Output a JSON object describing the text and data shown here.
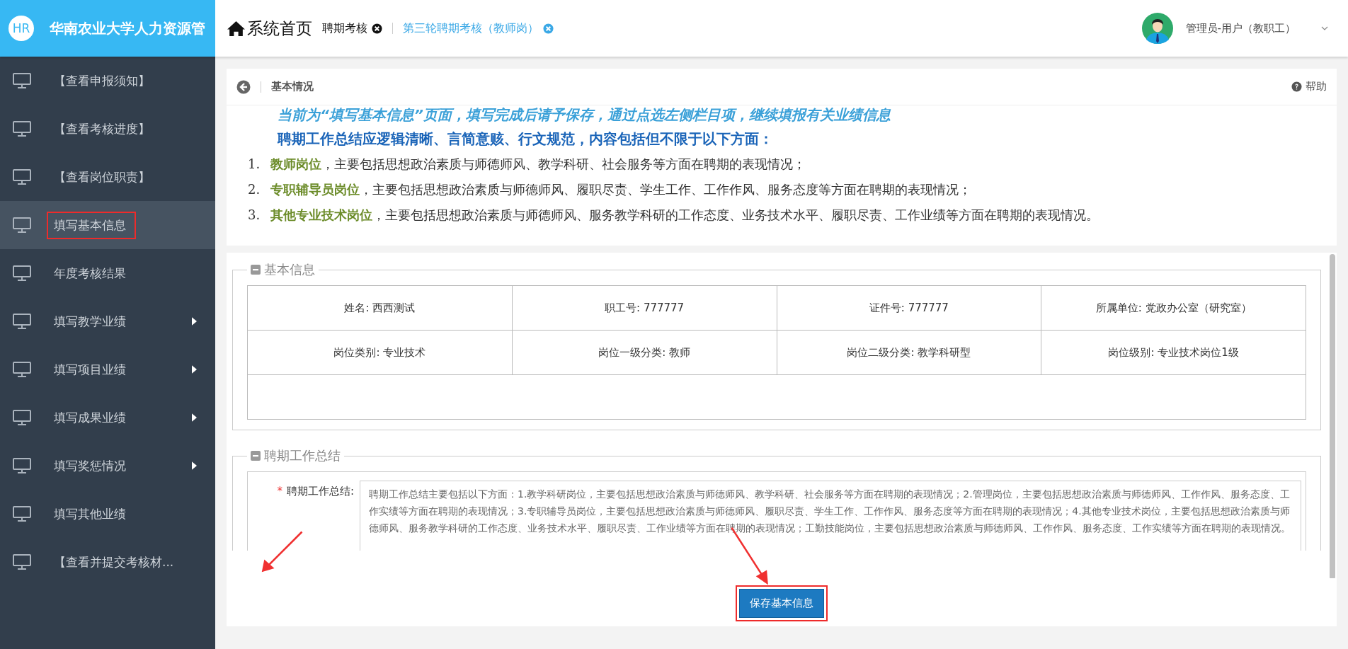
{
  "brand": {
    "logo": "HR",
    "title": "华南农业大学人力资源管"
  },
  "tabs": [
    {
      "label": "系统首页",
      "kind": "home",
      "selected": false
    },
    {
      "label": "聘期考核",
      "kind": "closable",
      "selected": false
    },
    {
      "label": "第三轮聘期考核（教师岗）",
      "kind": "closable",
      "selected": true
    }
  ],
  "user": {
    "name": "管理员-用户（教职工）"
  },
  "sidebar": {
    "items": [
      {
        "label": "【查看申报须知】",
        "selected": false,
        "has_submenu": false,
        "annotated": false
      },
      {
        "label": "【查看考核进度】",
        "selected": false,
        "has_submenu": false,
        "annotated": false
      },
      {
        "label": "【查看岗位职责】",
        "selected": false,
        "has_submenu": false,
        "annotated": false
      },
      {
        "label": "填写基本信息",
        "selected": true,
        "has_submenu": false,
        "annotated": true
      },
      {
        "label": "年度考核结果",
        "selected": false,
        "has_submenu": false,
        "annotated": false
      },
      {
        "label": "填写教学业绩",
        "selected": false,
        "has_submenu": true,
        "annotated": false
      },
      {
        "label": "填写项目业绩",
        "selected": false,
        "has_submenu": true,
        "annotated": false
      },
      {
        "label": "填写成果业绩",
        "selected": false,
        "has_submenu": true,
        "annotated": false
      },
      {
        "label": "填写奖惩情况",
        "selected": false,
        "has_submenu": true,
        "annotated": false
      },
      {
        "label": "填写其他业绩",
        "selected": false,
        "has_submenu": false,
        "annotated": false
      },
      {
        "label": "【查看并提交考核材...",
        "selected": false,
        "has_submenu": false,
        "annotated": false
      }
    ]
  },
  "breadcrumb": {
    "title": "基本情况",
    "help": "帮助"
  },
  "instructions": {
    "notice": "当前为“填写基本信息”页面，填写完成后请予保存，通过点选左侧栏目项，继续填报有关业绩信息",
    "heading": "聘期工作总结应逻辑清晰、言简意赅、行文规范，内容包括但不限于以下方面：",
    "items": [
      {
        "number": "1.",
        "title": "教师岗位",
        "text": "，主要包括思想政治素质与师德师风、教学科研、社会服务等方面在聘期的表现情况；"
      },
      {
        "number": "2.",
        "title": "专职辅导员岗位",
        "text": "，主要包括思想政治素质与师德师风、履职尽责、学生工作、工作作风、服务态度等方面在聘期的表现情况；"
      },
      {
        "number": "3.",
        "title": "其他专业技术岗位",
        "text": "，主要包括思想政治素质与师德师风、服务教学科研的工作态度、业务技术水平、履职尽责、工作业绩等方面在聘期的表现情况。"
      }
    ]
  },
  "basic_info": {
    "legend": "基本信息",
    "rows": [
      [
        "姓名: 西西测试",
        "职工号: 777777",
        "证件号: 777777",
        "所属单位: 党政办公室（研究室）"
      ],
      [
        "岗位类别: 专业技术",
        "岗位一级分类: 教师",
        "岗位二级分类: 教学科研型",
        "岗位级别: 专业技术岗位1级"
      ]
    ]
  },
  "summary": {
    "legend": "聘期工作总结",
    "required_mark": "*",
    "label": "聘期工作总结:",
    "value": "聘期工作总结主要包括以下方面：1.教学科研岗位，主要包括思想政治素质与师德师风、教学科研、社会服务等方面在聘期的表现情况；2.管理岗位，主要包括思想政治素质与师德师风、工作作风、服务态度、工作实绩等方面在聘期的表现情况；3.专职辅导员岗位，主要包括思想政治素质与师德师风、履职尽责、学生工作、工作作风、服务态度等方面在聘期的表现情况；4.其他专业技术岗位，主要包括思想政治素质与师德师风、服务教学科研的工作态度、业务技术水平、履职尽责、工作业绩等方面在聘期的表现情况；工勤技能岗位，主要包括思想政治素质与师德师风、工作作风、服务态度、工作实绩等方面在聘期的表现情况。"
  },
  "save_button": {
    "label": "保存基本信息",
    "annotated": true
  }
}
